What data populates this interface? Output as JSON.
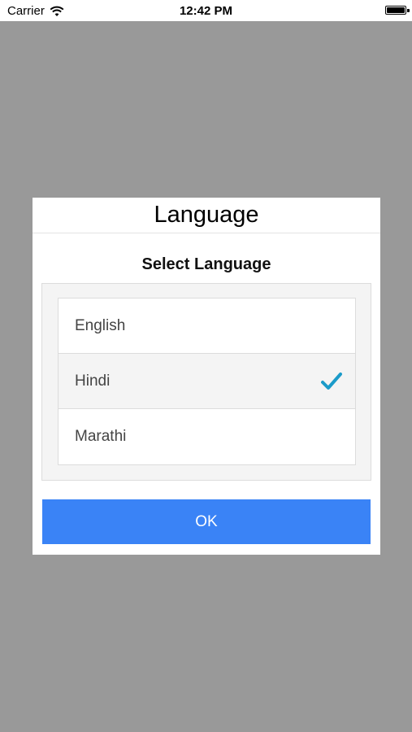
{
  "status_bar": {
    "carrier": "Carrier",
    "time": "12:42 PM"
  },
  "dialog": {
    "title": "Language",
    "subtitle": "Select Language",
    "options": [
      {
        "label": "English",
        "selected": false
      },
      {
        "label": "Hindi",
        "selected": true
      },
      {
        "label": "Marathi",
        "selected": false
      }
    ],
    "ok_label": "OK"
  },
  "colors": {
    "backdrop": "#999999",
    "accent_check": "#1b9bc9",
    "ok_button": "#3a83f6"
  },
  "icons": {
    "wifi": "wifi-icon",
    "battery": "battery-icon",
    "selected": "checkmark-icon"
  }
}
